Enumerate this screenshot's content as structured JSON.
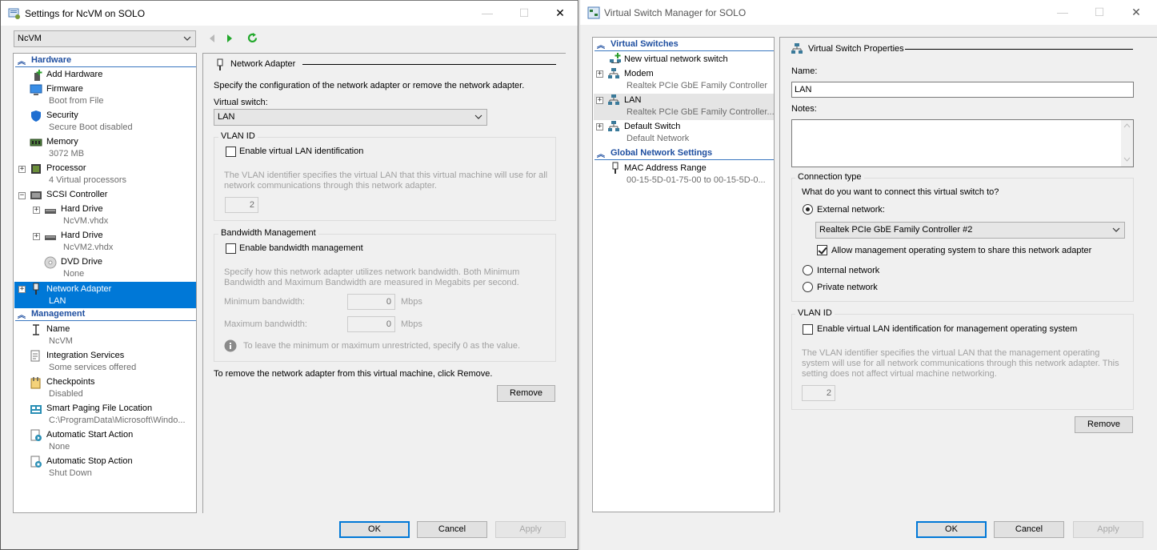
{
  "settings_window": {
    "title": "Settings for NcVM on SOLO",
    "vm_select": "NcVM",
    "hardware_header": "Hardware",
    "management_header": "Management",
    "hardware_items": [
      {
        "label": "Add Hardware",
        "sub": ""
      },
      {
        "label": "Firmware",
        "sub": "Boot from File"
      },
      {
        "label": "Security",
        "sub": "Secure Boot disabled"
      },
      {
        "label": "Memory",
        "sub": "3072 MB"
      },
      {
        "label": "Processor",
        "sub": "4 Virtual processors"
      },
      {
        "label": "SCSI Controller",
        "sub": ""
      },
      {
        "label": "Hard Drive",
        "sub": "NcVM.vhdx"
      },
      {
        "label": "Hard Drive",
        "sub": "NcVM2.vhdx"
      },
      {
        "label": "DVD Drive",
        "sub": "None"
      },
      {
        "label": "Network Adapter",
        "sub": "LAN"
      }
    ],
    "management_items": [
      {
        "label": "Name",
        "sub": "NcVM"
      },
      {
        "label": "Integration Services",
        "sub": "Some services offered"
      },
      {
        "label": "Checkpoints",
        "sub": "Disabled"
      },
      {
        "label": "Smart Paging File Location",
        "sub": "C:\\ProgramData\\Microsoft\\Windo..."
      },
      {
        "label": "Automatic Start Action",
        "sub": "None"
      },
      {
        "label": "Automatic Stop Action",
        "sub": "Shut Down"
      }
    ],
    "detail": {
      "title": "Network Adapter",
      "description": "Specify the configuration of the network adapter or remove the network adapter.",
      "virtual_switch_label": "Virtual switch:",
      "virtual_switch_value": "LAN",
      "vlan_group": "VLAN ID",
      "vlan_checkbox": "Enable virtual LAN identification",
      "vlan_help": "The VLAN identifier specifies the virtual LAN that this virtual machine will use for all network communications through this network adapter.",
      "vlan_value": "2",
      "bw_group": "Bandwidth Management",
      "bw_checkbox": "Enable bandwidth management",
      "bw_help": "Specify how this network adapter utilizes network bandwidth. Both Minimum Bandwidth and Maximum Bandwidth are measured in Megabits per second.",
      "min_bw_label": "Minimum bandwidth:",
      "min_bw_value": "0",
      "max_bw_label": "Maximum bandwidth:",
      "max_bw_value": "0",
      "unit": "Mbps",
      "info_text": "To leave the minimum or maximum unrestricted, specify 0 as the value.",
      "remove_text": "To remove the network adapter from this virtual machine, click Remove.",
      "remove_button": "Remove"
    },
    "buttons": {
      "ok": "OK",
      "cancel": "Cancel",
      "apply": "Apply"
    }
  },
  "switch_window": {
    "title": "Virtual Switch Manager for SOLO",
    "virtual_switches_header": "Virtual Switches",
    "global_header": "Global Network Settings",
    "switch_items": [
      {
        "label": "New virtual network switch",
        "sub": ""
      },
      {
        "label": "Modem",
        "sub": "Realtek PCIe GbE Family Controller"
      },
      {
        "label": "LAN",
        "sub": "Realtek PCIe GbE Family Controller..."
      },
      {
        "label": "Default Switch",
        "sub": "Default Network"
      }
    ],
    "global_items": [
      {
        "label": "MAC Address Range",
        "sub": "00-15-5D-01-75-00 to 00-15-5D-0..."
      }
    ],
    "properties": {
      "title": "Virtual Switch Properties",
      "name_label": "Name:",
      "name_value": "LAN",
      "notes_label": "Notes:",
      "notes_value": "",
      "connection_group": "Connection type",
      "connection_question": "What do you want to connect this virtual switch to?",
      "external": "External network:",
      "external_adapter": "Realtek PCIe GbE Family Controller #2",
      "allow_mgmt": "Allow management operating system to share this network adapter",
      "internal": "Internal network",
      "private": "Private network",
      "vlan_group": "VLAN ID",
      "vlan_checkbox": "Enable virtual LAN identification for management operating system",
      "vlan_help": "The VLAN identifier specifies the virtual LAN that the management operating system will use for all network communications through this network adapter. This setting does not affect virtual machine networking.",
      "vlan_value": "2",
      "remove_button": "Remove"
    },
    "buttons": {
      "ok": "OK",
      "cancel": "Cancel",
      "apply": "Apply"
    }
  }
}
